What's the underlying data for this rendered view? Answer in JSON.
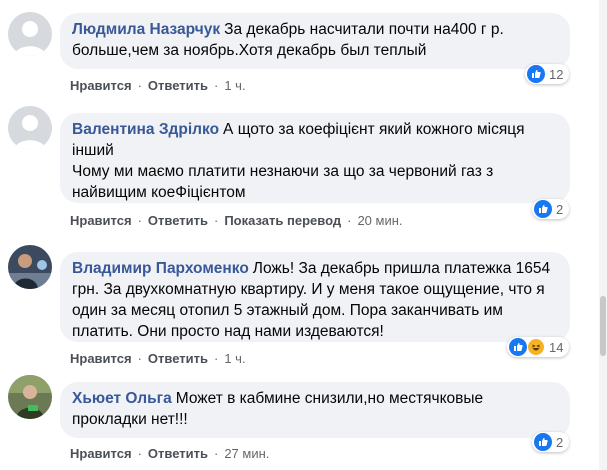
{
  "comments": [
    {
      "author": "Людмила Назарчук",
      "text": "За декабрь насчитали почти на400 г р. больше,чем за ноябрь.Хотя декабрь был теплый",
      "actions": {
        "like": "Нравится",
        "reply": "Ответить",
        "translate": "",
        "time": "1 ч."
      },
      "reactions": {
        "count": "12",
        "types": [
          "like"
        ]
      }
    },
    {
      "author": "Валентина Здрілко",
      "text": "А щото за коефіцієнт який кожного місяця інший\nЧому ми маємо платити незнаючи за що за червоний газ з найвищим коеФіцієнтом",
      "actions": {
        "like": "Нравится",
        "reply": "Ответить",
        "translate": "Показать перевод",
        "time": "20 мин."
      },
      "reactions": {
        "count": "2",
        "types": [
          "like"
        ]
      }
    },
    {
      "author": "Владимир Пархоменко",
      "text": "Ложь! За декабрь пришла платежка 1654 грн. За двухкомнатную квартиру. И у меня такое ощущение, что я один за месяц отопил 5 этажный дом. Пора заканчивать им платить. Они просто над нами издеваются!",
      "actions": {
        "like": "Нравится",
        "reply": "Ответить",
        "translate": "",
        "time": "1 ч."
      },
      "reactions": {
        "count": "14",
        "types": [
          "like",
          "haha"
        ]
      }
    },
    {
      "author": "Хьюет Ольга",
      "text": "Может в кабмине снизили,но местячковые прокладки нет!!!",
      "actions": {
        "like": "Нравится",
        "reply": "Ответить",
        "translate": "",
        "time": "27 мин."
      },
      "reactions": {
        "count": "2",
        "types": [
          "like"
        ]
      }
    }
  ],
  "colors": {
    "author": "#385898",
    "bubble": "#f0f2f5",
    "like": "#1877f2",
    "haha": "#f7b125",
    "meta": "#65676b"
  }
}
